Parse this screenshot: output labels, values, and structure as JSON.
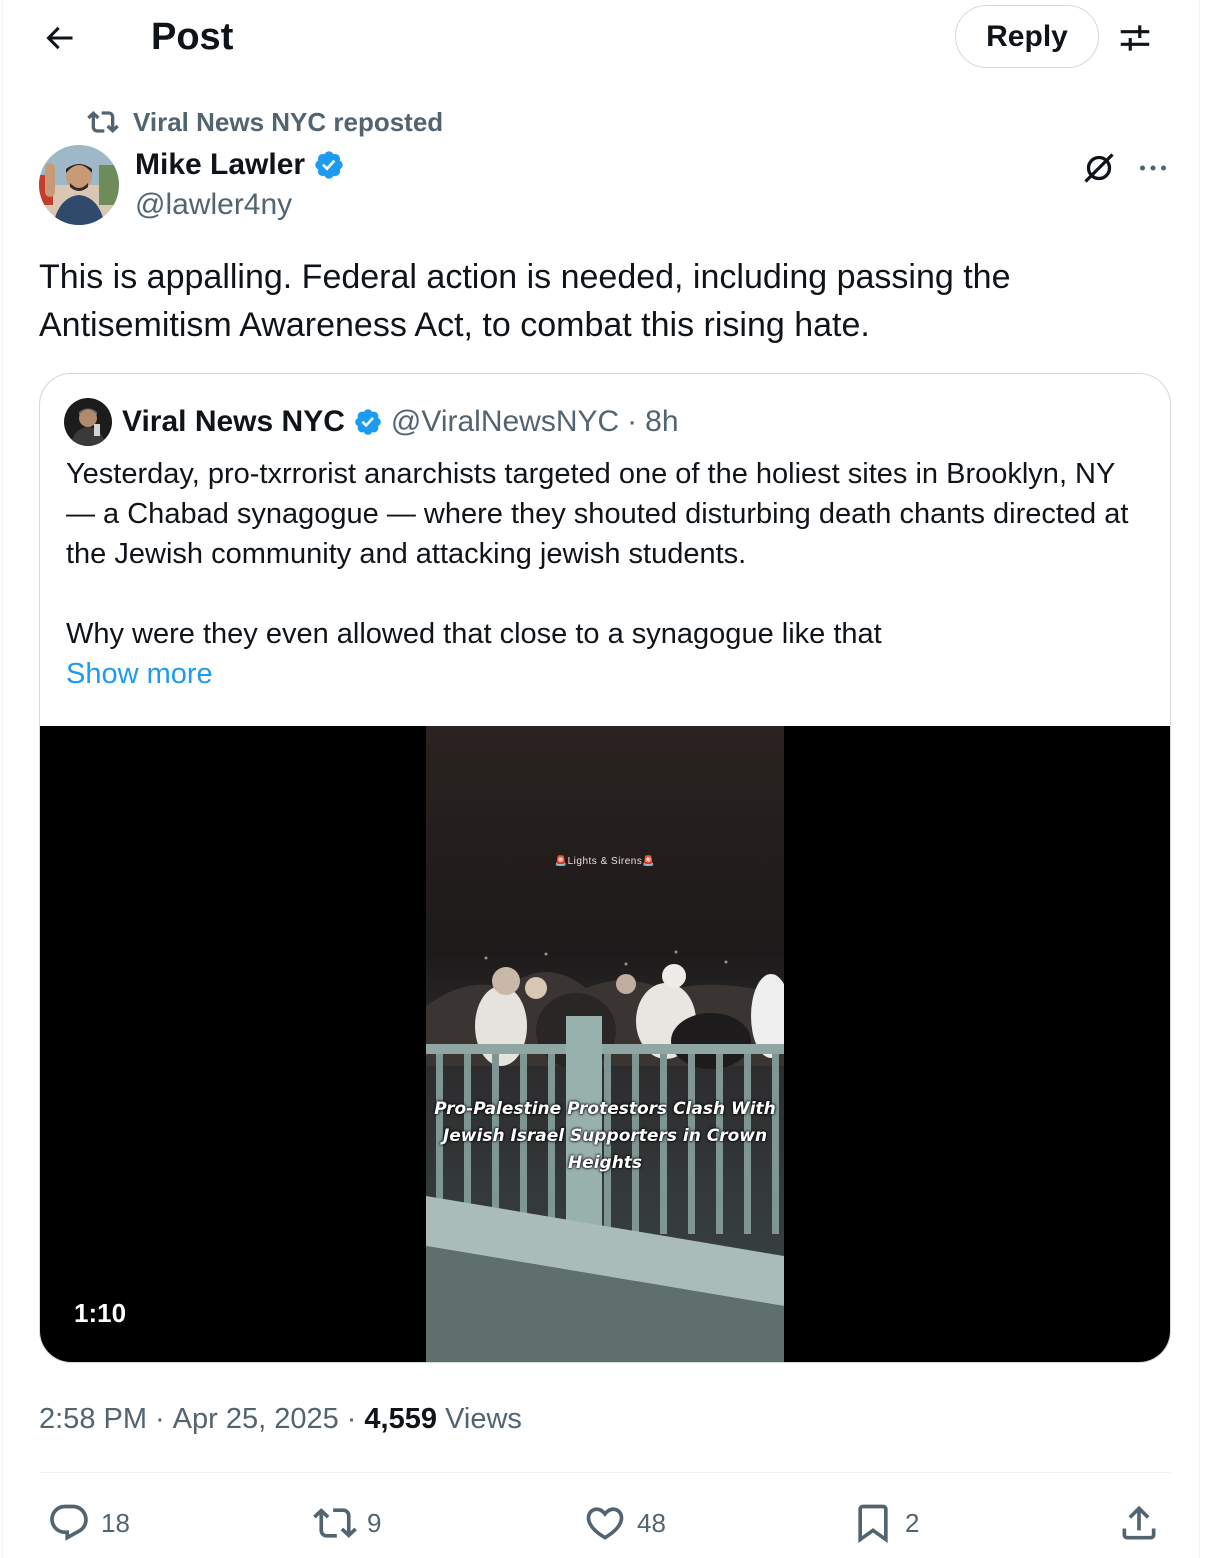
{
  "header": {
    "title": "Post",
    "reply_label": "Reply"
  },
  "repost": {
    "label": "Viral News NYC reposted"
  },
  "author": {
    "name": "Mike Lawler",
    "handle": "@lawler4ny",
    "verified": true
  },
  "post": {
    "text": "This is appalling. Federal action is needed, including passing the Antisemitism Awareness Act, to combat this rising hate."
  },
  "quote": {
    "name": "Viral News NYC",
    "handle": "@ViralNewsNYC",
    "separator": "·",
    "time": "8h",
    "paragraph1": "Yesterday, pro-txrrorist anarchists targeted one of the holiest sites in Brooklyn, NY — a Chabad synagogue — where they shouted disturbing death chants directed at the Jewish community and attacking jewish students.",
    "paragraph2": "Why were they even allowed that close to a synagogue like that",
    "show_more": "Show more",
    "video": {
      "duration": "1:10",
      "caption": "Pro-Palestine Protestors Clash With Jewish Israel Supporters in Crown Heights",
      "watermark": "🚨Lights & Sirens🚨"
    }
  },
  "meta": {
    "time": "2:58 PM",
    "sep1": "·",
    "date": "Apr 25, 2025",
    "sep2": "·",
    "views_count": "4,559",
    "views_label": "Views"
  },
  "actions": {
    "replies": "18",
    "reposts": "9",
    "likes": "48",
    "bookmarks": "2"
  },
  "colors": {
    "accent": "#1d9bf0",
    "secondary_text": "#536471",
    "primary_text": "#0f1419"
  }
}
